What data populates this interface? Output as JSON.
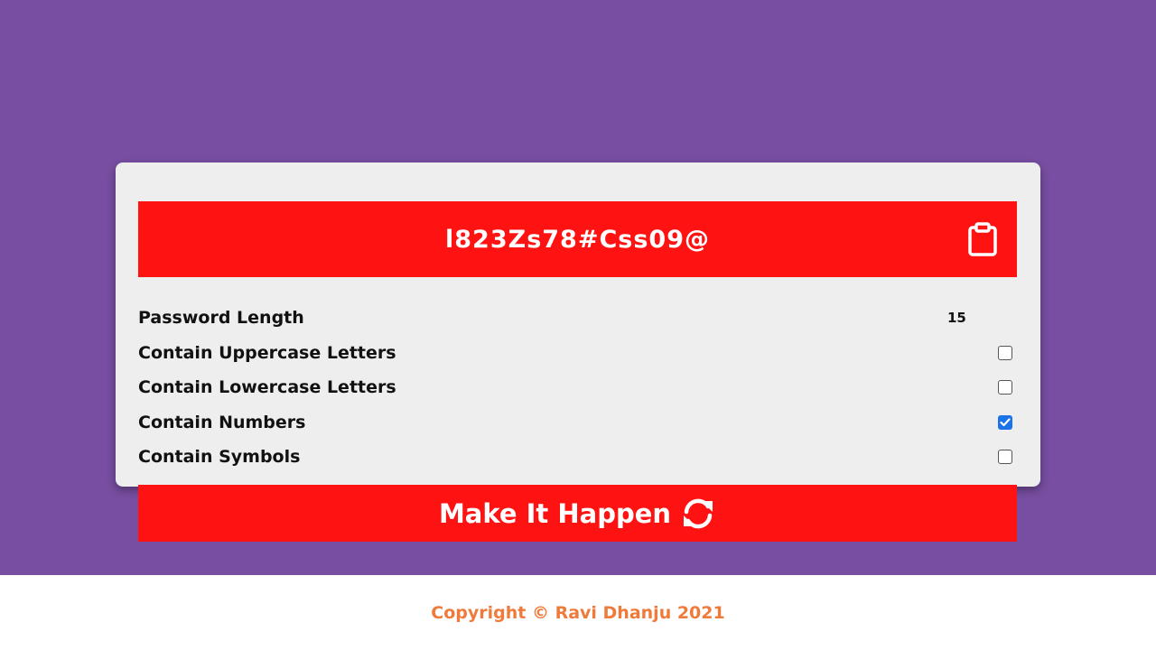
{
  "colors": {
    "background": "#774ea1",
    "card": "#eeeeee",
    "accent": "#ff1212",
    "checkbox_checked": "#1a73e8",
    "footer_text": "#f07a3a"
  },
  "result": {
    "password": "l823Zs78#Css09@",
    "copy_icon": "clipboard-icon"
  },
  "settings": {
    "length": {
      "label": "Password Length",
      "value": "15"
    },
    "options": [
      {
        "label": "Contain Uppercase Letters",
        "checked": false
      },
      {
        "label": "Contain Lowercase Letters",
        "checked": false
      },
      {
        "label": "Contain Numbers",
        "checked": true
      },
      {
        "label": "Contain Symbols",
        "checked": false
      }
    ]
  },
  "generate_button": {
    "label": "Make It Happen",
    "icon": "refresh-icon"
  },
  "footer": {
    "copyright": "Copyright © Ravi Dhanju 2021"
  }
}
